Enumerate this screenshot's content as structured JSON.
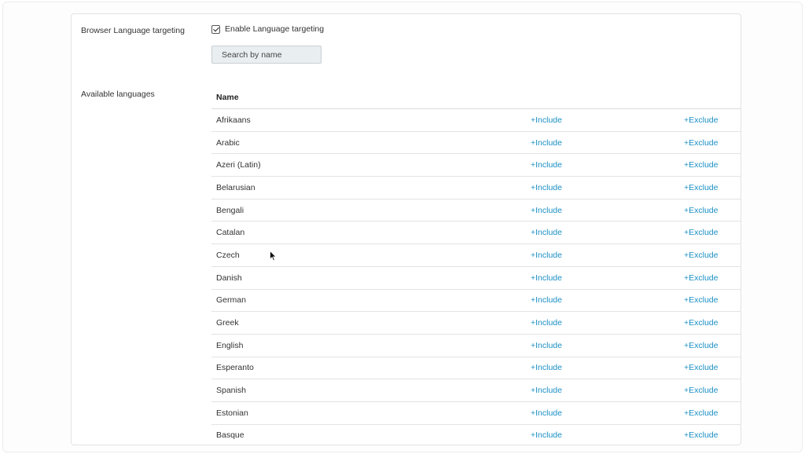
{
  "settings": {
    "browser_language_label": "Browser Language targeting",
    "enable_checkbox_label": "Enable Language targeting",
    "enable_checked": true,
    "search_placeholder": "Search by name",
    "available_languages_label": "Available languages"
  },
  "table": {
    "name_header": "Name",
    "include_label": "+Include",
    "exclude_label": "+Exclude",
    "rows": [
      "Afrikaans",
      "Arabic",
      "Azeri (Latin)",
      "Belarusian",
      "Bengali",
      "Catalan",
      "Czech",
      "Danish",
      "German",
      "Greek",
      "English",
      "Esperanto",
      "Spanish",
      "Estonian",
      "Basque"
    ]
  },
  "colors": {
    "link": "#1a8fc4",
    "search_bg": "#e9eef0"
  },
  "icons": {
    "cursor": "mouse-pointer-icon",
    "checkbox": "checkmark-icon"
  }
}
